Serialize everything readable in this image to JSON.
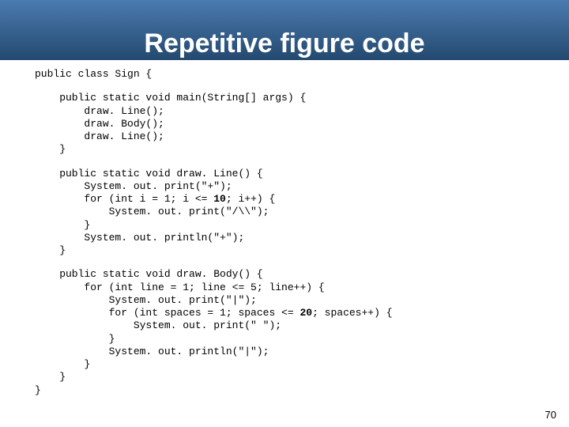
{
  "header": {
    "title": "Repetitive figure code"
  },
  "code": {
    "decl": "public class Sign {",
    "main": "    public static void main(String[] args) {\n        draw. Line();\n        draw. Body();\n        draw. Line();\n    }",
    "drawLine_sig": "    public static void draw. Line() {",
    "drawLine_body": "        System. out. print(\"+\");\n        for (int i = 1; i <= 10; i++) {\n            System. out. print(\"/\\\\\");\n        }\n        System. out. println(\"+\");\n    }",
    "drawBody_sig": "    public static void draw. Body() {",
    "drawBody_body": "        for (int line = 1; line <= 5; line++) {\n            System. out. print(\"|\");\n            for (int spaces = 1; spaces <= 20; spaces++) {\n                System. out. print(\" \");\n            }\n            System. out. println(\"|\");\n        }\n    }\n}",
    "bold": {
      "ten": "10",
      "twenty": "20"
    }
  },
  "page": {
    "number": "70"
  }
}
